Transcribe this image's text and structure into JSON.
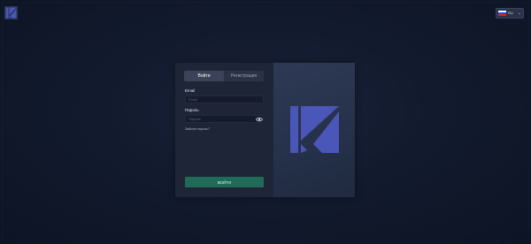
{
  "header": {
    "logo_icon": "brand-logo-icon",
    "language": {
      "code": "RU",
      "flag_colors": [
        "#ffffff",
        "#1f4fd6",
        "#d81e2c"
      ],
      "icon": "chevron-down-icon"
    }
  },
  "auth": {
    "tabs": [
      {
        "label": "Войти",
        "active": true
      },
      {
        "label": "Регистрация",
        "active": false
      }
    ],
    "email": {
      "label": "Email",
      "placeholder": "Email",
      "value": ""
    },
    "password": {
      "label": "Пароль",
      "placeholder": "Пароль",
      "value": "",
      "icon": "eye-icon"
    },
    "forgot_label": "Забыли пароль?",
    "submit_label": "ВОЙТИ"
  },
  "colors": {
    "background": "#0f1628",
    "card_form": "#1e2537",
    "card_art": "#26324b",
    "brand_blue": "#4a56b8",
    "submit_green": "#1f6b58"
  }
}
